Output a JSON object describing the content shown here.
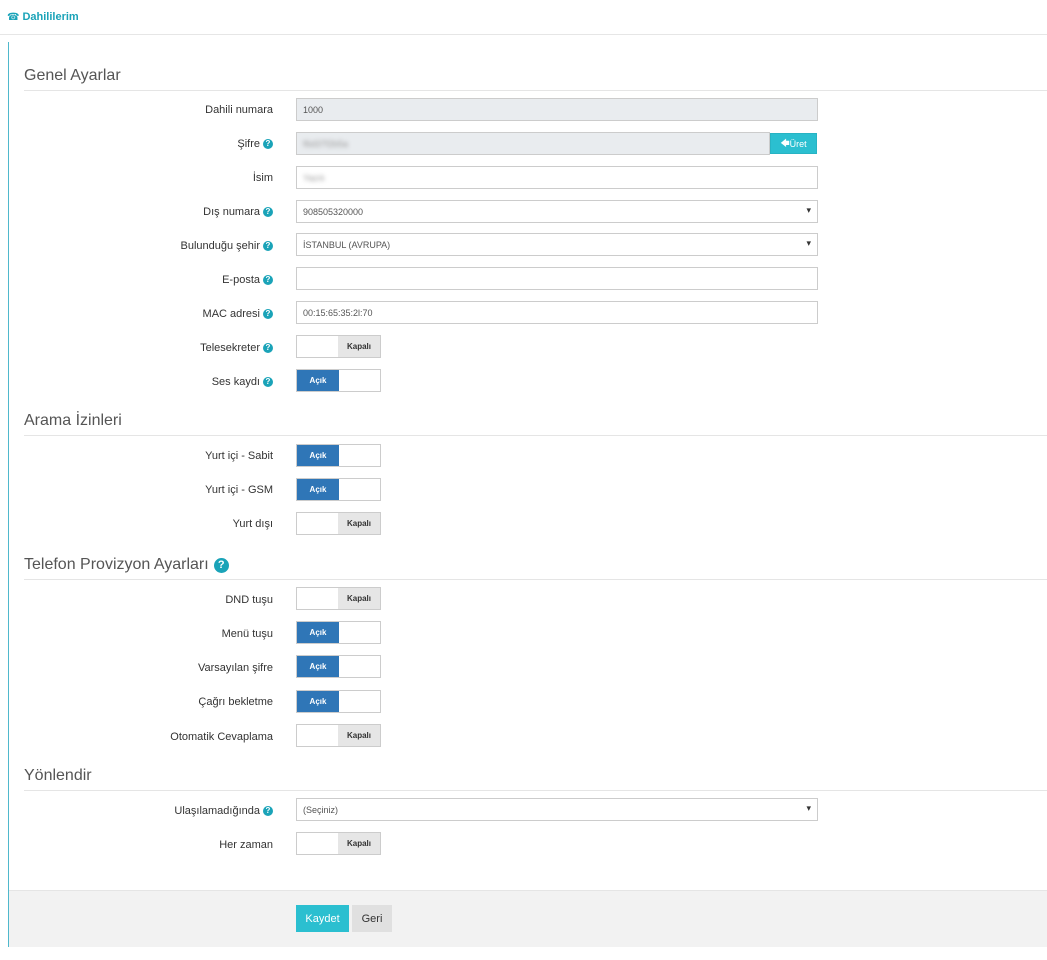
{
  "header": {
    "title": "Dahililerim",
    "icon": "phone-icon"
  },
  "colors": {
    "accent": "#2bbfd0",
    "toggle_on": "#2f76b7",
    "toggle_off": "#e6e6e6"
  },
  "sections": {
    "genel": "Genel Ayarlar",
    "arama": "Arama İzinleri",
    "provizyon": "Telefon Provizyon Ayarları",
    "yonlendir": "Yönlendir"
  },
  "fields": {
    "dahili_numara": {
      "label": "Dahili numara",
      "value": "1000"
    },
    "sifre": {
      "label": "Şifre",
      "value": "f6d37f2b5a",
      "button": "Üret"
    },
    "isim": {
      "label": "İsim",
      "value": "Yazılı"
    },
    "dis_numara": {
      "label": "Dış numara",
      "value": "908505320000"
    },
    "sehir": {
      "label": "Bulunduğu şehir",
      "value": "İSTANBUL (AVRUPA)"
    },
    "eposta": {
      "label": "E-posta",
      "value": ""
    },
    "mac": {
      "label": "MAC adresi",
      "value": "00:15:65:35:2l:70"
    },
    "ulasilamadiginda": {
      "label": "Ulaşılamadığında",
      "value": "(Seçiniz)"
    }
  },
  "toggles": {
    "telesekreter": {
      "label": "Telesekreter",
      "state": "Kapalı"
    },
    "ses_kaydi": {
      "label": "Ses kaydı",
      "state": "Açık"
    },
    "yurt_ici_sabit": {
      "label": "Yurt içi - Sabit",
      "state": "Açık"
    },
    "yurt_ici_gsm": {
      "label": "Yurt içi - GSM",
      "state": "Açık"
    },
    "yurt_disi": {
      "label": "Yurt dışı",
      "state": "Kapalı"
    },
    "dnd": {
      "label": "DND tuşu",
      "state": "Kapalı"
    },
    "menu": {
      "label": "Menü tuşu",
      "state": "Açık"
    },
    "varsayilan_sifre": {
      "label": "Varsayılan şifre",
      "state": "Açık"
    },
    "cagri_bekletme": {
      "label": "Çağrı bekletme",
      "state": "Açık"
    },
    "otomatik_cevaplama": {
      "label": "Otomatik Cevaplama",
      "state": "Kapalı"
    },
    "her_zaman": {
      "label": "Her zaman",
      "state": "Kapalı"
    }
  },
  "footer": {
    "save": "Kaydet",
    "back": "Geri"
  }
}
